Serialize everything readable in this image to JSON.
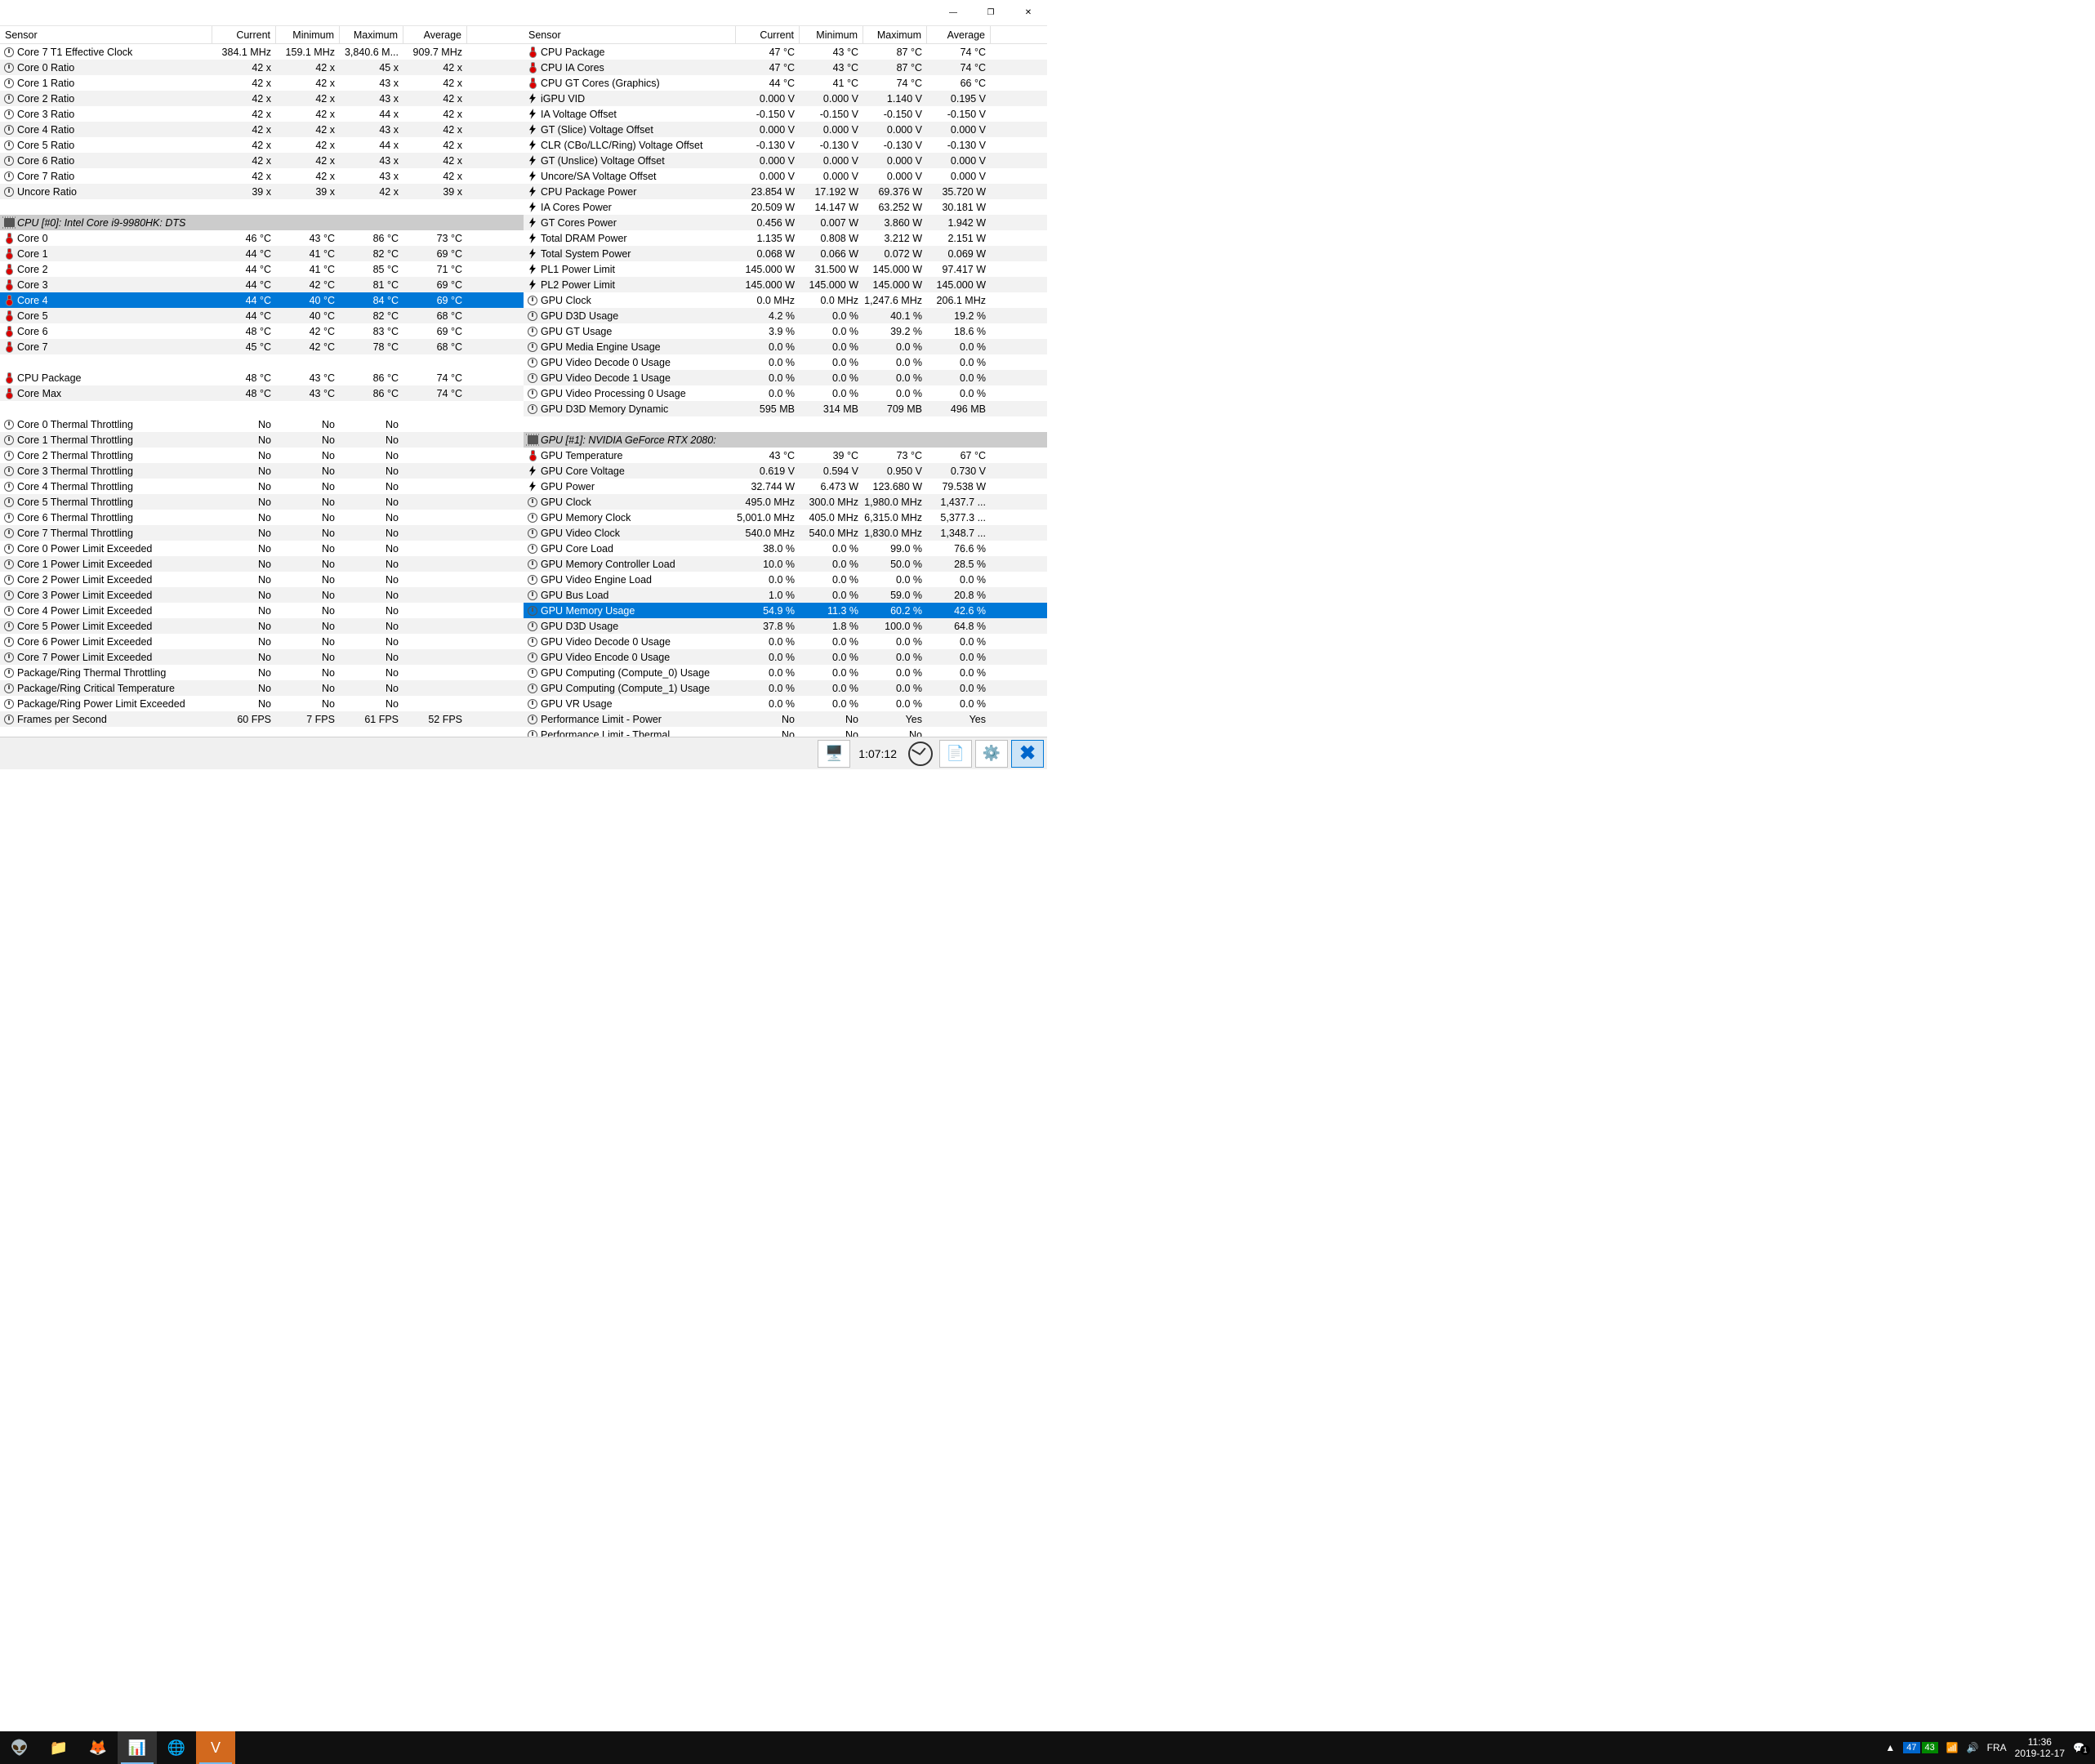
{
  "titlebar": {
    "min": "—",
    "max": "❐",
    "close": "✕"
  },
  "headers": [
    "Sensor",
    "Current",
    "Minimum",
    "Maximum",
    "Average"
  ],
  "statusbar": {
    "uptime": "1:07:12"
  },
  "taskbar": {
    "cpu_temp": "47",
    "gpu_temp": "43",
    "lang": "FRA",
    "time": "11:36",
    "date": "2019-12-17"
  },
  "left": [
    {
      "ic": "clock",
      "n": "Core 7 T1 Effective Clock",
      "v": [
        "384.1 MHz",
        "159.1 MHz",
        "3,840.6 M...",
        "909.7 MHz"
      ]
    },
    {
      "ic": "clock",
      "n": "Core 0 Ratio",
      "v": [
        "42 x",
        "42 x",
        "45 x",
        "42 x"
      ]
    },
    {
      "ic": "clock",
      "n": "Core 1 Ratio",
      "v": [
        "42 x",
        "42 x",
        "43 x",
        "42 x"
      ]
    },
    {
      "ic": "clock",
      "n": "Core 2 Ratio",
      "v": [
        "42 x",
        "42 x",
        "43 x",
        "42 x"
      ]
    },
    {
      "ic": "clock",
      "n": "Core 3 Ratio",
      "v": [
        "42 x",
        "42 x",
        "44 x",
        "42 x"
      ]
    },
    {
      "ic": "clock",
      "n": "Core 4 Ratio",
      "v": [
        "42 x",
        "42 x",
        "43 x",
        "42 x"
      ]
    },
    {
      "ic": "clock",
      "n": "Core 5 Ratio",
      "v": [
        "42 x",
        "42 x",
        "44 x",
        "42 x"
      ]
    },
    {
      "ic": "clock",
      "n": "Core 6 Ratio",
      "v": [
        "42 x",
        "42 x",
        "43 x",
        "42 x"
      ]
    },
    {
      "ic": "clock",
      "n": "Core 7 Ratio",
      "v": [
        "42 x",
        "42 x",
        "43 x",
        "42 x"
      ]
    },
    {
      "ic": "clock",
      "n": "Uncore Ratio",
      "v": [
        "39 x",
        "39 x",
        "42 x",
        "39 x"
      ]
    },
    {
      "blank": true
    },
    {
      "grp": true,
      "ic": "chip",
      "n": "CPU [#0]: Intel Core i9-9980HK: DTS"
    },
    {
      "ic": "therm",
      "n": "Core 0",
      "v": [
        "46 °C",
        "43 °C",
        "86 °C",
        "73 °C"
      ]
    },
    {
      "ic": "therm",
      "n": "Core 1",
      "v": [
        "44 °C",
        "41 °C",
        "82 °C",
        "69 °C"
      ]
    },
    {
      "ic": "therm",
      "n": "Core 2",
      "v": [
        "44 °C",
        "41 °C",
        "85 °C",
        "71 °C"
      ]
    },
    {
      "ic": "therm",
      "n": "Core 3",
      "v": [
        "44 °C",
        "42 °C",
        "81 °C",
        "69 °C"
      ]
    },
    {
      "ic": "therm",
      "n": "Core 4",
      "v": [
        "44 °C",
        "40 °C",
        "84 °C",
        "69 °C"
      ],
      "sel": true
    },
    {
      "ic": "therm",
      "n": "Core 5",
      "v": [
        "44 °C",
        "40 °C",
        "82 °C",
        "68 °C"
      ]
    },
    {
      "ic": "therm",
      "n": "Core 6",
      "v": [
        "48 °C",
        "42 °C",
        "83 °C",
        "69 °C"
      ]
    },
    {
      "ic": "therm",
      "n": "Core 7",
      "v": [
        "45 °C",
        "42 °C",
        "78 °C",
        "68 °C"
      ]
    },
    {
      "blank": true
    },
    {
      "ic": "therm",
      "n": "CPU Package",
      "v": [
        "48 °C",
        "43 °C",
        "86 °C",
        "74 °C"
      ]
    },
    {
      "ic": "therm",
      "n": "Core Max",
      "v": [
        "48 °C",
        "43 °C",
        "86 °C",
        "74 °C"
      ]
    },
    {
      "blank": true
    },
    {
      "ic": "clock",
      "n": "Core 0 Thermal Throttling",
      "v": [
        "No",
        "No",
        "No",
        ""
      ]
    },
    {
      "ic": "clock",
      "n": "Core 1 Thermal Throttling",
      "v": [
        "No",
        "No",
        "No",
        ""
      ]
    },
    {
      "ic": "clock",
      "n": "Core 2 Thermal Throttling",
      "v": [
        "No",
        "No",
        "No",
        ""
      ]
    },
    {
      "ic": "clock",
      "n": "Core 3 Thermal Throttling",
      "v": [
        "No",
        "No",
        "No",
        ""
      ]
    },
    {
      "ic": "clock",
      "n": "Core 4 Thermal Throttling",
      "v": [
        "No",
        "No",
        "No",
        ""
      ]
    },
    {
      "ic": "clock",
      "n": "Core 5 Thermal Throttling",
      "v": [
        "No",
        "No",
        "No",
        ""
      ]
    },
    {
      "ic": "clock",
      "n": "Core 6 Thermal Throttling",
      "v": [
        "No",
        "No",
        "No",
        ""
      ]
    },
    {
      "ic": "clock",
      "n": "Core 7 Thermal Throttling",
      "v": [
        "No",
        "No",
        "No",
        ""
      ]
    },
    {
      "ic": "clock",
      "n": "Core 0 Power Limit Exceeded",
      "v": [
        "No",
        "No",
        "No",
        ""
      ]
    },
    {
      "ic": "clock",
      "n": "Core 1 Power Limit Exceeded",
      "v": [
        "No",
        "No",
        "No",
        ""
      ]
    },
    {
      "ic": "clock",
      "n": "Core 2 Power Limit Exceeded",
      "v": [
        "No",
        "No",
        "No",
        ""
      ]
    },
    {
      "ic": "clock",
      "n": "Core 3 Power Limit Exceeded",
      "v": [
        "No",
        "No",
        "No",
        ""
      ]
    },
    {
      "ic": "clock",
      "n": "Core 4 Power Limit Exceeded",
      "v": [
        "No",
        "No",
        "No",
        ""
      ]
    },
    {
      "ic": "clock",
      "n": "Core 5 Power Limit Exceeded",
      "v": [
        "No",
        "No",
        "No",
        ""
      ]
    },
    {
      "ic": "clock",
      "n": "Core 6 Power Limit Exceeded",
      "v": [
        "No",
        "No",
        "No",
        ""
      ]
    },
    {
      "ic": "clock",
      "n": "Core 7 Power Limit Exceeded",
      "v": [
        "No",
        "No",
        "No",
        ""
      ]
    },
    {
      "ic": "clock",
      "n": "Package/Ring Thermal Throttling",
      "v": [
        "No",
        "No",
        "No",
        ""
      ]
    },
    {
      "ic": "clock",
      "n": "Package/Ring Critical Temperature",
      "v": [
        "No",
        "No",
        "No",
        ""
      ]
    },
    {
      "ic": "clock",
      "n": "Package/Ring Power Limit Exceeded",
      "v": [
        "No",
        "No",
        "No",
        ""
      ]
    },
    {
      "ic": "clock",
      "n": "Frames per Second",
      "v": [
        "60 FPS",
        "7 FPS",
        "61 FPS",
        "52 FPS"
      ]
    }
  ],
  "right": [
    {
      "ic": "therm",
      "n": "CPU Package",
      "v": [
        "47 °C",
        "43 °C",
        "87 °C",
        "74 °C"
      ]
    },
    {
      "ic": "therm",
      "n": "CPU IA Cores",
      "v": [
        "47 °C",
        "43 °C",
        "87 °C",
        "74 °C"
      ]
    },
    {
      "ic": "therm",
      "n": "CPU GT Cores (Graphics)",
      "v": [
        "44 °C",
        "41 °C",
        "74 °C",
        "66 °C"
      ]
    },
    {
      "ic": "bolt",
      "n": "iGPU VID",
      "v": [
        "0.000 V",
        "0.000 V",
        "1.140 V",
        "0.195 V"
      ]
    },
    {
      "ic": "bolt",
      "n": "IA Voltage Offset",
      "v": [
        "-0.150 V",
        "-0.150 V",
        "-0.150 V",
        "-0.150 V"
      ]
    },
    {
      "ic": "bolt",
      "n": "GT (Slice) Voltage Offset",
      "v": [
        "0.000 V",
        "0.000 V",
        "0.000 V",
        "0.000 V"
      ]
    },
    {
      "ic": "bolt",
      "n": "CLR (CBo/LLC/Ring) Voltage Offset",
      "v": [
        "-0.130 V",
        "-0.130 V",
        "-0.130 V",
        "-0.130 V"
      ]
    },
    {
      "ic": "bolt",
      "n": "GT (Unslice) Voltage Offset",
      "v": [
        "0.000 V",
        "0.000 V",
        "0.000 V",
        "0.000 V"
      ]
    },
    {
      "ic": "bolt",
      "n": "Uncore/SA Voltage Offset",
      "v": [
        "0.000 V",
        "0.000 V",
        "0.000 V",
        "0.000 V"
      ]
    },
    {
      "ic": "bolt",
      "n": "CPU Package Power",
      "v": [
        "23.854 W",
        "17.192 W",
        "69.376 W",
        "35.720 W"
      ]
    },
    {
      "ic": "bolt",
      "n": "IA Cores Power",
      "v": [
        "20.509 W",
        "14.147 W",
        "63.252 W",
        "30.181 W"
      ]
    },
    {
      "ic": "bolt",
      "n": "GT Cores Power",
      "v": [
        "0.456 W",
        "0.007 W",
        "3.860 W",
        "1.942 W"
      ]
    },
    {
      "ic": "bolt",
      "n": "Total DRAM Power",
      "v": [
        "1.135 W",
        "0.808 W",
        "3.212 W",
        "2.151 W"
      ]
    },
    {
      "ic": "bolt",
      "n": "Total System Power",
      "v": [
        "0.068 W",
        "0.066 W",
        "0.072 W",
        "0.069 W"
      ]
    },
    {
      "ic": "bolt",
      "n": "PL1 Power Limit",
      "v": [
        "145.000 W",
        "31.500 W",
        "145.000 W",
        "97.417 W"
      ]
    },
    {
      "ic": "bolt",
      "n": "PL2 Power Limit",
      "v": [
        "145.000 W",
        "145.000 W",
        "145.000 W",
        "145.000 W"
      ]
    },
    {
      "ic": "clock",
      "n": "GPU Clock",
      "v": [
        "0.0 MHz",
        "0.0 MHz",
        "1,247.6 MHz",
        "206.1 MHz"
      ]
    },
    {
      "ic": "clock",
      "n": "GPU D3D Usage",
      "v": [
        "4.2 %",
        "0.0 %",
        "40.1 %",
        "19.2 %"
      ]
    },
    {
      "ic": "clock",
      "n": "GPU GT Usage",
      "v": [
        "3.9 %",
        "0.0 %",
        "39.2 %",
        "18.6 %"
      ]
    },
    {
      "ic": "clock",
      "n": "GPU Media Engine Usage",
      "v": [
        "0.0 %",
        "0.0 %",
        "0.0 %",
        "0.0 %"
      ]
    },
    {
      "ic": "clock",
      "n": "GPU Video Decode 0 Usage",
      "v": [
        "0.0 %",
        "0.0 %",
        "0.0 %",
        "0.0 %"
      ]
    },
    {
      "ic": "clock",
      "n": "GPU Video Decode 1 Usage",
      "v": [
        "0.0 %",
        "0.0 %",
        "0.0 %",
        "0.0 %"
      ]
    },
    {
      "ic": "clock",
      "n": "GPU Video Processing 0 Usage",
      "v": [
        "0.0 %",
        "0.0 %",
        "0.0 %",
        "0.0 %"
      ]
    },
    {
      "ic": "clock",
      "n": "GPU D3D Memory Dynamic",
      "v": [
        "595 MB",
        "314 MB",
        "709 MB",
        "496 MB"
      ]
    },
    {
      "blank": true
    },
    {
      "grp": true,
      "ic": "chip",
      "n": "GPU [#1]: NVIDIA GeForce RTX 2080:"
    },
    {
      "ic": "therm",
      "n": "GPU Temperature",
      "v": [
        "43 °C",
        "39 °C",
        "73 °C",
        "67 °C"
      ]
    },
    {
      "ic": "bolt",
      "n": "GPU Core Voltage",
      "v": [
        "0.619 V",
        "0.594 V",
        "0.950 V",
        "0.730 V"
      ]
    },
    {
      "ic": "bolt",
      "n": "GPU Power",
      "v": [
        "32.744 W",
        "6.473 W",
        "123.680 W",
        "79.538 W"
      ]
    },
    {
      "ic": "clock",
      "n": "GPU Clock",
      "v": [
        "495.0 MHz",
        "300.0 MHz",
        "1,980.0 MHz",
        "1,437.7 ..."
      ]
    },
    {
      "ic": "clock",
      "n": "GPU Memory Clock",
      "v": [
        "5,001.0 MHz",
        "405.0 MHz",
        "6,315.0 MHz",
        "5,377.3 ..."
      ]
    },
    {
      "ic": "clock",
      "n": "GPU Video Clock",
      "v": [
        "540.0 MHz",
        "540.0 MHz",
        "1,830.0 MHz",
        "1,348.7 ..."
      ]
    },
    {
      "ic": "clock",
      "n": "GPU Core Load",
      "v": [
        "38.0 %",
        "0.0 %",
        "99.0 %",
        "76.6 %"
      ]
    },
    {
      "ic": "clock",
      "n": "GPU Memory Controller Load",
      "v": [
        "10.0 %",
        "0.0 %",
        "50.0 %",
        "28.5 %"
      ]
    },
    {
      "ic": "clock",
      "n": "GPU Video Engine Load",
      "v": [
        "0.0 %",
        "0.0 %",
        "0.0 %",
        "0.0 %"
      ]
    },
    {
      "ic": "clock",
      "n": "GPU Bus Load",
      "v": [
        "1.0 %",
        "0.0 %",
        "59.0 %",
        "20.8 %"
      ]
    },
    {
      "ic": "clock",
      "n": "GPU Memory Usage",
      "v": [
        "54.9 %",
        "11.3 %",
        "60.2 %",
        "42.6 %"
      ],
      "sel": true
    },
    {
      "ic": "clock",
      "n": "GPU D3D Usage",
      "v": [
        "37.8 %",
        "1.8 %",
        "100.0 %",
        "64.8 %"
      ]
    },
    {
      "ic": "clock",
      "n": "GPU Video Decode 0 Usage",
      "v": [
        "0.0 %",
        "0.0 %",
        "0.0 %",
        "0.0 %"
      ]
    },
    {
      "ic": "clock",
      "n": "GPU Video Encode 0 Usage",
      "v": [
        "0.0 %",
        "0.0 %",
        "0.0 %",
        "0.0 %"
      ]
    },
    {
      "ic": "clock",
      "n": "GPU Computing (Compute_0) Usage",
      "v": [
        "0.0 %",
        "0.0 %",
        "0.0 %",
        "0.0 %"
      ]
    },
    {
      "ic": "clock",
      "n": "GPU Computing (Compute_1) Usage",
      "v": [
        "0.0 %",
        "0.0 %",
        "0.0 %",
        "0.0 %"
      ]
    },
    {
      "ic": "clock",
      "n": "GPU VR Usage",
      "v": [
        "0.0 %",
        "0.0 %",
        "0.0 %",
        "0.0 %"
      ]
    },
    {
      "ic": "clock",
      "n": "Performance Limit - Power",
      "v": [
        "No",
        "No",
        "Yes",
        "Yes"
      ]
    },
    {
      "ic": "clock",
      "n": "Performance Limit - Thermal",
      "v": [
        "No",
        "No",
        "No",
        ""
      ]
    }
  ]
}
